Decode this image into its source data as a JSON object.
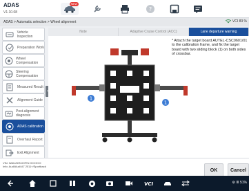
{
  "app": {
    "title": "ADAS",
    "version": "V1.10.08"
  },
  "toolbar": {
    "badge": "NEW"
  },
  "breadcrumb": {
    "text": "ADAS > Automatic selection > Wheel alignment",
    "vci": "VCI",
    "status": "VCI 83 %"
  },
  "sidebar": {
    "items": [
      {
        "label": "Vehicle Inspection"
      },
      {
        "label": "Preparation Work"
      },
      {
        "label": "Wheel Compensation"
      },
      {
        "label": "Steering Compensation"
      },
      {
        "label": "Measured Result"
      },
      {
        "label": "Alignment Guide"
      },
      {
        "label": "Post-alignment diagnosis"
      },
      {
        "label": "ADAS calibration"
      },
      {
        "label": "Overhaul Report"
      },
      {
        "label": "Exit Alignment"
      }
    ]
  },
  "tabs": [
    {
      "label": "Note"
    },
    {
      "label": "Adaptive Cruise Control (ACC)"
    },
    {
      "label": "Lane departure warning"
    }
  ],
  "instructions": "* Attach the target board AUTEL-CSC0601/01 to the calibration frame, and fix the target board with two sliding block (1) on both sides of crossbar.",
  "illustration": {
    "callout_left": "1",
    "callout_right": "1"
  },
  "vehicle": {
    "vin": "VIN: WAUZZZ4G7EN ХХХХХХ",
    "info": "Info: Audi/Audi A7 2011+/Sportback"
  },
  "actions": {
    "ok": "OK",
    "cancel": "Cancel"
  },
  "statusbar": {
    "text": "⚙ ≣ 51%"
  }
}
